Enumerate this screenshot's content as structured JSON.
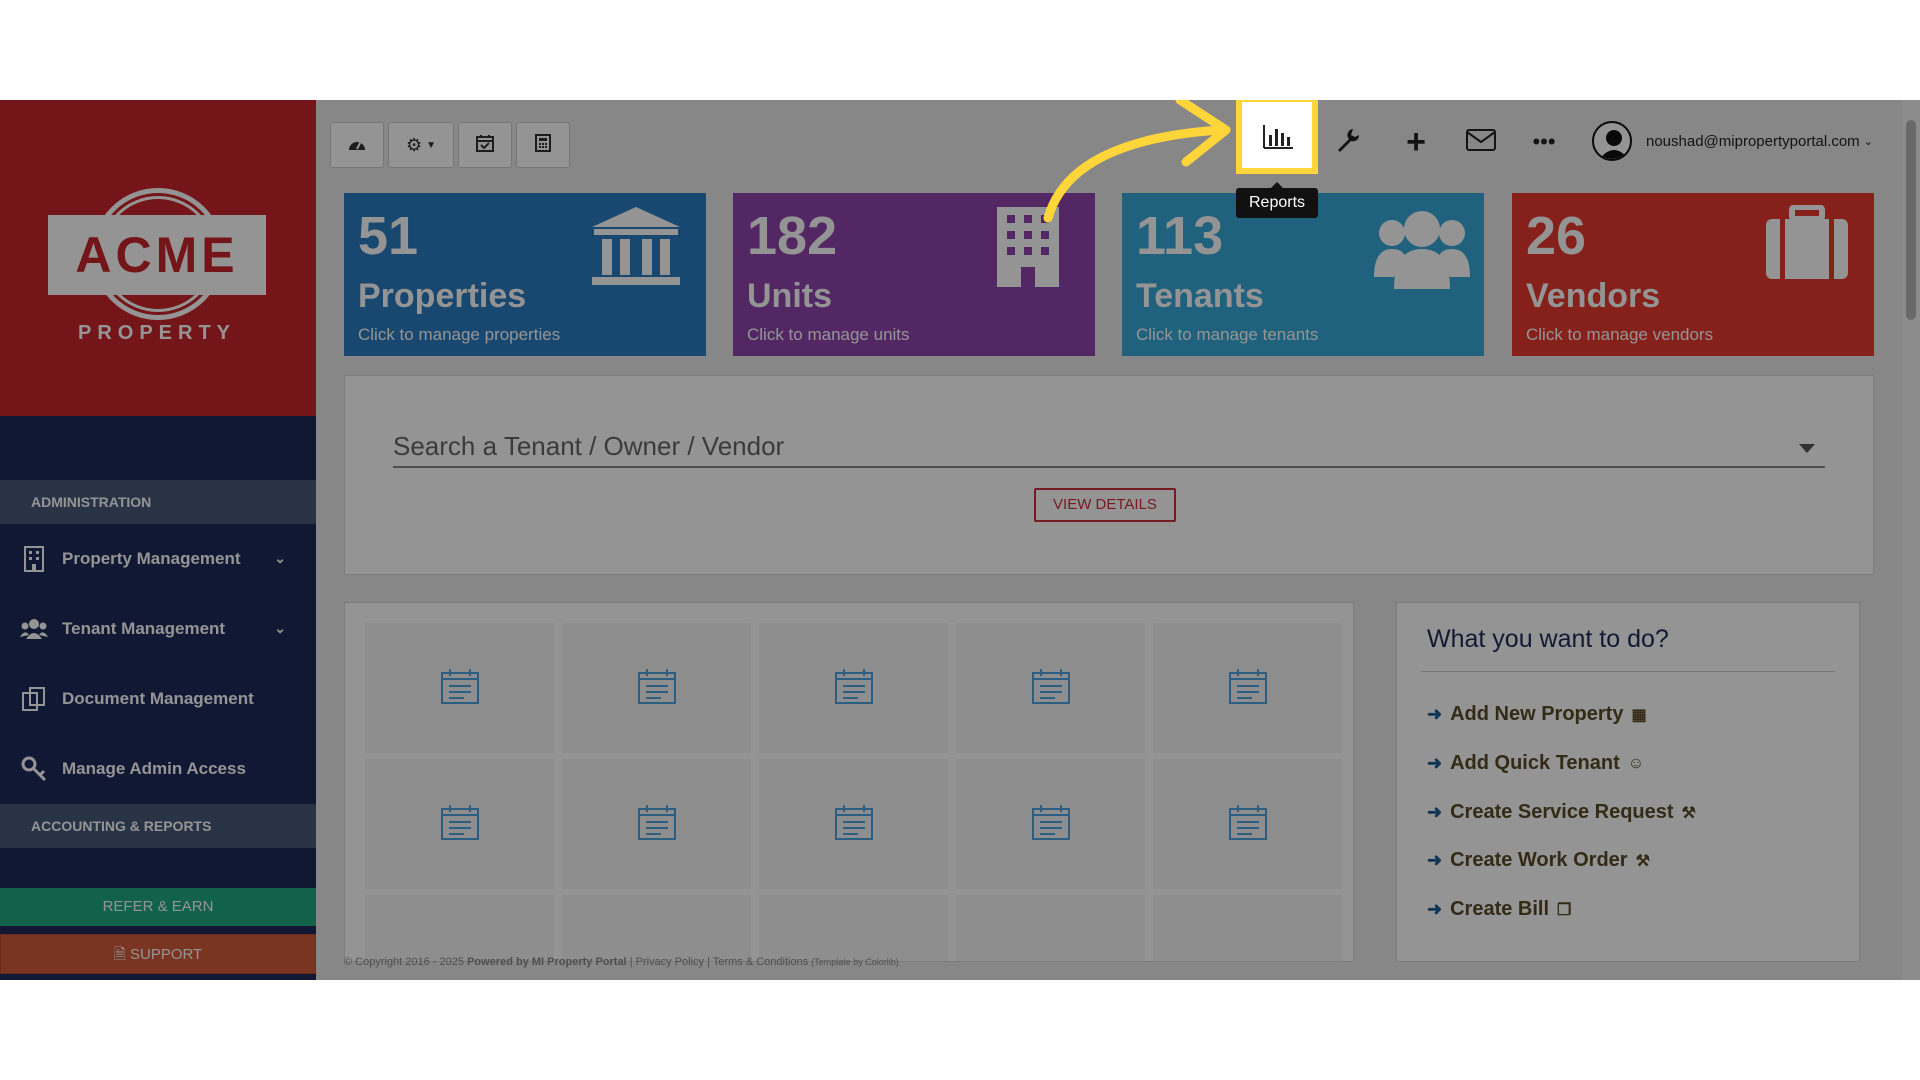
{
  "sidebar": {
    "logo_text": "ACME",
    "logo_sub": "PROPERTY",
    "section_admin": "ADMINISTRATION",
    "items": [
      {
        "label": "Property Management",
        "icon": "building-icon",
        "has_chevron": true
      },
      {
        "label": "Tenant Management",
        "icon": "users-icon",
        "has_chevron": true
      },
      {
        "label": "Document Management",
        "icon": "documents-icon",
        "has_chevron": false
      },
      {
        "label": "Manage Admin Access",
        "icon": "key-icon",
        "has_chevron": false
      }
    ],
    "section_accounting": "ACCOUNTING & REPORTS",
    "refer_label": "REFER & EARN",
    "support_label": "SUPPORT"
  },
  "toolbar": {
    "left_buttons": [
      "dashboard-icon",
      "settings-icon",
      "calendar-check-icon",
      "calculator-icon"
    ],
    "reports_tooltip": "Reports",
    "icons": [
      "bar-chart-icon",
      "wrench-icon",
      "plus-icon",
      "envelope-icon",
      "more-icon"
    ],
    "user_email": "noushad@mipropertyportal.com"
  },
  "stats": [
    {
      "number": "51",
      "label": "Properties",
      "sub": "Click to manage properties",
      "color": "#2a7bbf",
      "icon": "bank-icon"
    },
    {
      "number": "182",
      "label": "Units",
      "sub": "Click to manage units",
      "color": "#8e44ad",
      "icon": "building-icon"
    },
    {
      "number": "113",
      "label": "Tenants",
      "sub": "Click to manage tenants",
      "color": "#37a9d7",
      "icon": "users-icon"
    },
    {
      "number": "26",
      "label": "Vendors",
      "sub": "Click to manage vendors",
      "color": "#e5372f",
      "icon": "briefcase-icon"
    }
  ],
  "search": {
    "placeholder": "Search a Tenant / Owner / Vendor",
    "view_details": "VIEW DETAILS"
  },
  "quick_actions": {
    "title": "What you want to do?",
    "items": [
      {
        "label": "Add New Property",
        "icon": "building-icon"
      },
      {
        "label": "Add Quick Tenant",
        "icon": "user-icon"
      },
      {
        "label": "Create Service Request",
        "icon": "wrench-icon"
      },
      {
        "label": "Create Work Order",
        "icon": "wrench-icon"
      },
      {
        "label": "Create Bill",
        "icon": "copy-icon"
      }
    ]
  },
  "footer": {
    "copyright": "© Copyright 2016 - 2025",
    "powered": "Powered by MI Property Portal",
    "links": "| Privacy Policy | Terms & Conditions",
    "template": "(Template by Colorlib)"
  }
}
